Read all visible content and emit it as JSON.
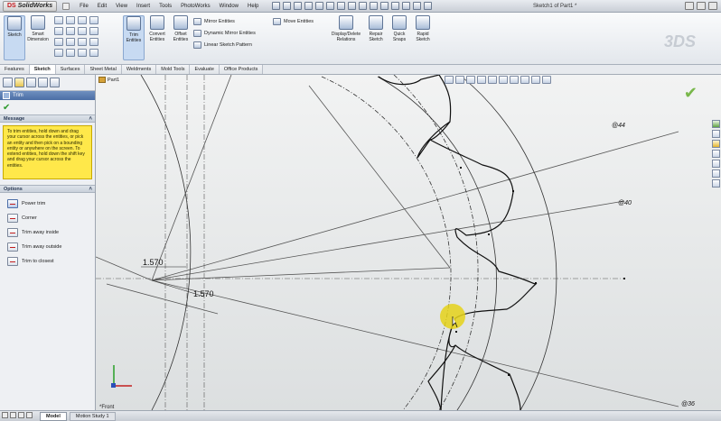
{
  "app": {
    "brand_prefix": "DS",
    "brand_name": "SolidWorks",
    "document_title": "Sketch1 of Part1 *"
  },
  "menu": [
    "File",
    "Edit",
    "View",
    "Insert",
    "Tools",
    "PhotoWorks",
    "Window",
    "Help"
  ],
  "command_manager": {
    "sketch": "Sketch",
    "smart_dimension": "Smart Dimension",
    "trim_entities": "Trim Entities",
    "convert_entities": "Convert Entities",
    "offset_entities": "Offset Entities",
    "mirror_entities": "Mirror Entities",
    "dynamic_mirror": "Dynamic Mirror Entities",
    "linear_pattern": "Linear Sketch Pattern",
    "move_entities": "Move Entities",
    "display_delete_relations": "Display/Delete Relations",
    "repair_sketch": "Repair Sketch",
    "quick_snaps": "Quick Snaps",
    "rapid_sketch": "Rapid Sketch"
  },
  "tabs": [
    {
      "label": "Features",
      "active": false
    },
    {
      "label": "Sketch",
      "active": true
    },
    {
      "label": "Surfaces",
      "active": false
    },
    {
      "label": "Sheet Metal",
      "active": false
    },
    {
      "label": "Weldments",
      "active": false
    },
    {
      "label": "Mold Tools",
      "active": false
    },
    {
      "label": "Evaluate",
      "active": false
    },
    {
      "label": "Office Products",
      "active": false
    }
  ],
  "property_manager": {
    "title": "Trim",
    "message_header": "Message",
    "message": "To trim entities, hold down and drag your cursor across the entities, or pick an entity and then pick on a bounding entity or anywhere on the screen. To extend entities, hold down the shift key and drag your cursor across the entities.",
    "options_header": "Options",
    "options": [
      {
        "label": "Power trim",
        "selected": true
      },
      {
        "label": "Corner",
        "selected": false
      },
      {
        "label": "Trim away inside",
        "selected": false
      },
      {
        "label": "Trim away outside",
        "selected": false
      },
      {
        "label": "Trim to closest",
        "selected": false
      }
    ]
  },
  "graphics": {
    "tree_root": "Part1",
    "dimensions": {
      "dim_a": "1.570",
      "dim_b": "1.570",
      "angle_44": "@44",
      "angle_40": "@40",
      "angle_36": "@36"
    },
    "view_label": "*Front"
  },
  "statusbar": {
    "model_tab": "Model",
    "motion_tab": "Motion Study 1"
  },
  "colors": {
    "highlight": "#e5d21a",
    "message_bg": "#ffe84a",
    "title_bar": "#4b6ea5"
  }
}
